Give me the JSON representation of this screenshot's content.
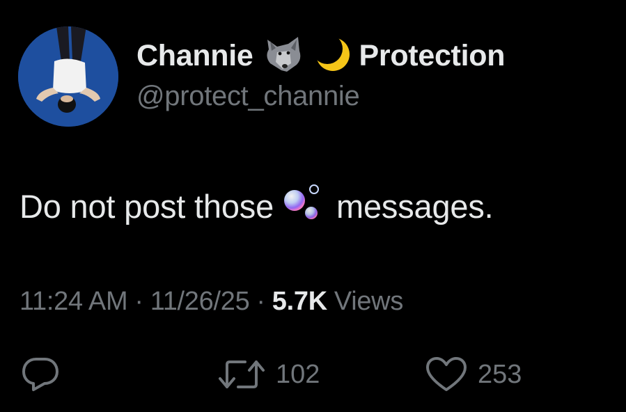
{
  "user": {
    "display_name": "Channie",
    "display_name_suffix": "Protection",
    "handle": "@protect_channie",
    "name_emojis": [
      "wolf-face-emoji",
      "crescent-moon-emoji"
    ]
  },
  "tweet": {
    "text_before": "Do not post those",
    "text_emoji": "bubbles-emoji",
    "text_after": "messages."
  },
  "meta": {
    "time": "11:24 AM",
    "separator": "·",
    "date": "11/26/25",
    "views_count": "5.7K",
    "views_label": "Views"
  },
  "actions": {
    "reply_icon": "reply-icon",
    "retweet_icon": "retweet-icon",
    "retweet_count": "102",
    "like_icon": "heart-icon",
    "like_count": "253"
  },
  "colors": {
    "background": "#000000",
    "primary_text": "#e7e9ea",
    "secondary_text": "#71767b",
    "avatar_bg": "#1f4c9c"
  }
}
